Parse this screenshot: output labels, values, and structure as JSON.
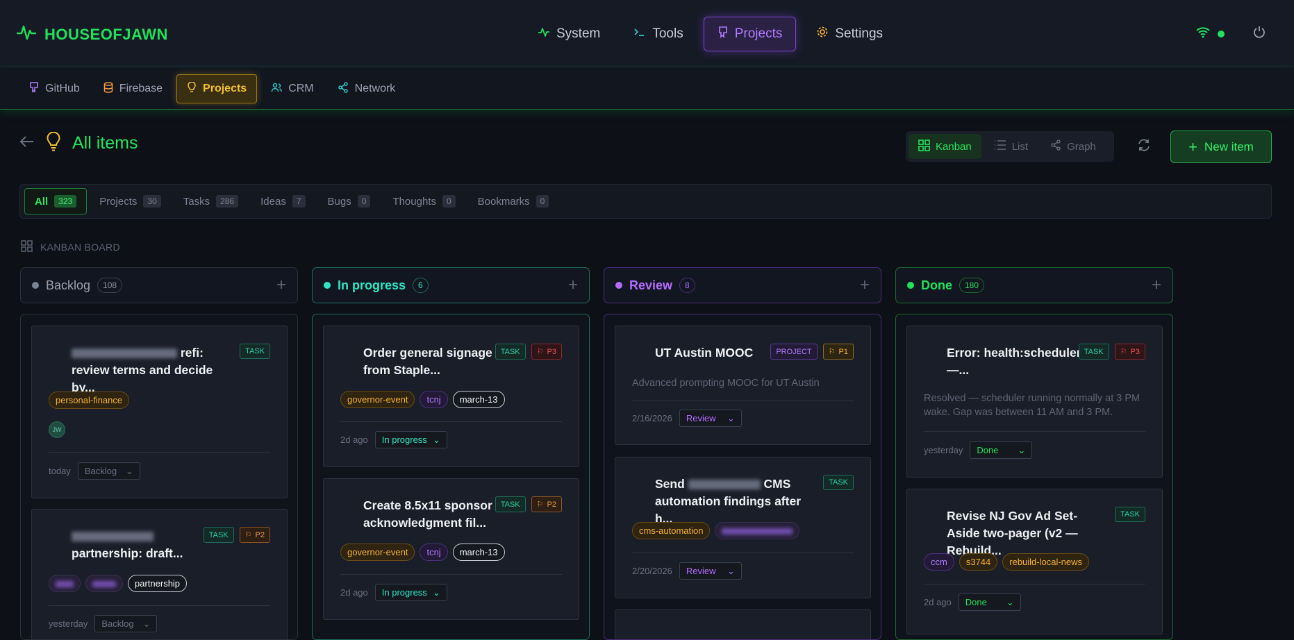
{
  "app": {
    "name": "HOUSEOFJAWN"
  },
  "nav": {
    "items": [
      {
        "label": "System",
        "icon": "activity-icon"
      },
      {
        "label": "Tools",
        "icon": "terminal-icon"
      },
      {
        "label": "Projects",
        "icon": "github-icon",
        "active": true
      },
      {
        "label": "Settings",
        "icon": "gear-icon"
      }
    ]
  },
  "subnav": {
    "items": [
      {
        "label": "GitHub",
        "icon": "github-icon"
      },
      {
        "label": "Firebase",
        "icon": "database-icon"
      },
      {
        "label": "Projects",
        "icon": "lightbulb-icon",
        "active": true
      },
      {
        "label": "CRM",
        "icon": "users-icon"
      },
      {
        "label": "Network",
        "icon": "share-icon"
      }
    ]
  },
  "page": {
    "title": "All items"
  },
  "views": {
    "kanban": "Kanban",
    "list": "List",
    "graph": "Graph",
    "active": "Kanban"
  },
  "new_item_label": "New item",
  "filters": [
    {
      "label": "All",
      "count": "323",
      "active": true
    },
    {
      "label": "Projects",
      "count": "30"
    },
    {
      "label": "Tasks",
      "count": "286"
    },
    {
      "label": "Ideas",
      "count": "7"
    },
    {
      "label": "Bugs",
      "count": "0"
    },
    {
      "label": "Thoughts",
      "count": "0"
    },
    {
      "label": "Bookmarks",
      "count": "0"
    }
  ],
  "board_label": "KANBAN BOARD",
  "colors": {
    "accent": "#22e05a",
    "backlog": "#7c8392",
    "in_progress": "#2ee6c3",
    "review": "#b36bff",
    "done": "#22e05a"
  },
  "columns": [
    {
      "title": "Backlog",
      "count": "108",
      "cards": [
        {
          "title_visible": "refi: review terms and decide by...",
          "type": "TASK",
          "tags": [
            "personal-finance"
          ],
          "assignee": "JW",
          "time": "today",
          "status": "Backlog"
        },
        {
          "title_visible": "partnership: draft...",
          "type": "TASK",
          "priority": "P2",
          "tags": [
            "partnership"
          ],
          "time": "yesterday",
          "status": "Backlog"
        }
      ]
    },
    {
      "title": "In progress",
      "count": "6",
      "cards": [
        {
          "title": "Order general signage from Staple...",
          "type": "TASK",
          "priority": "P3",
          "tags": [
            "governor-event",
            "tcnj",
            "march-13"
          ],
          "time": "2d ago",
          "status": "In progress"
        },
        {
          "title": "Create 8.5x11 sponsor acknowledgment fil...",
          "type": "TASK",
          "priority": "P2",
          "tags": [
            "governor-event",
            "tcnj",
            "march-13"
          ],
          "time": "2d ago",
          "status": "In progress"
        }
      ]
    },
    {
      "title": "Review",
      "count": "8",
      "cards": [
        {
          "title": "UT Austin MOOC",
          "type": "PROJECT",
          "priority": "P1",
          "description": "Advanced prompting MOOC for UT Austin",
          "time": "2/16/2026",
          "status": "Review"
        },
        {
          "title_prefix": "Send",
          "title_suffix": "CMS automation findings after h...",
          "type": "TASK",
          "tags": [
            "cms-automation"
          ],
          "time": "2/20/2026",
          "status": "Review"
        }
      ]
    },
    {
      "title": "Done",
      "count": "180",
      "cards": [
        {
          "title": "Error: health:scheduler —...",
          "type": "TASK",
          "priority": "P3",
          "description": "Resolved — scheduler running normally at 3 PM wake. Gap was between 11 AM and 3 PM.",
          "time": "yesterday",
          "status": "Done"
        },
        {
          "title": "Revise NJ Gov Ad Set-Aside two-pager (v2 — Rebuild...",
          "type": "TASK",
          "tags": [
            "ccm",
            "s3744",
            "rebuild-local-news"
          ],
          "time": "2d ago",
          "status": "Done"
        }
      ]
    }
  ]
}
